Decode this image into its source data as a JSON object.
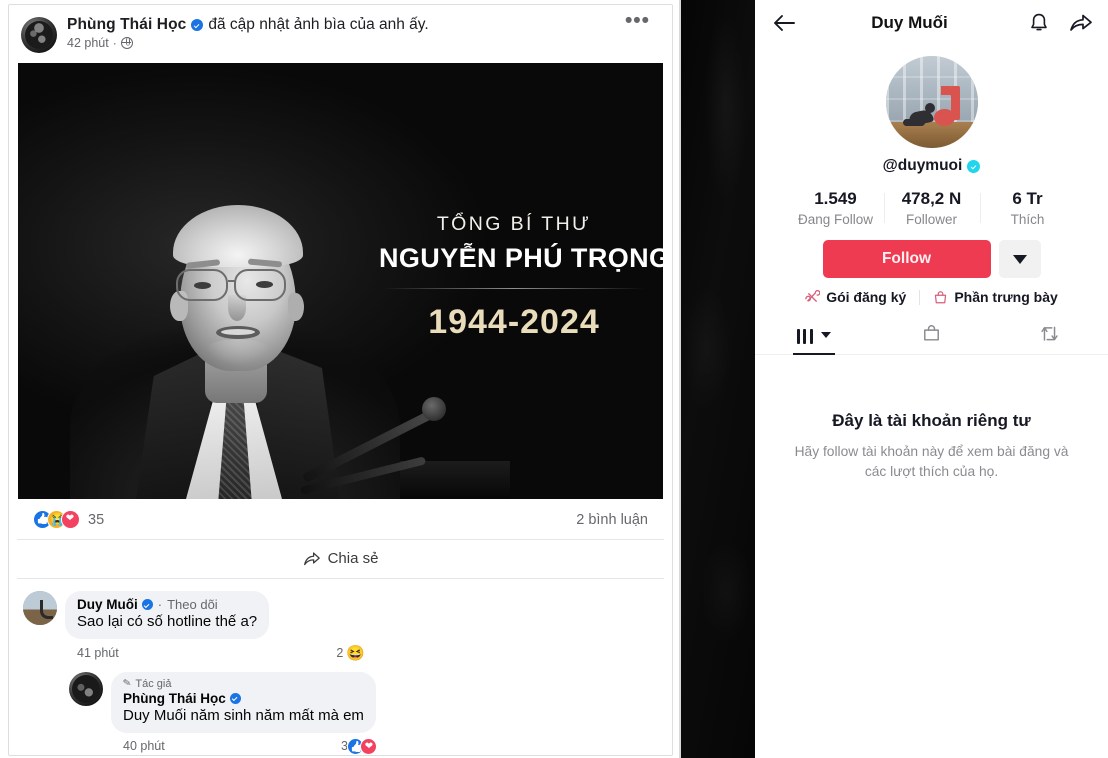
{
  "facebook_post": {
    "author_name": "Phùng Thái Học",
    "action_text": "đã cập nhật ảnh bìa của anh ấy.",
    "timestamp": "42 phút",
    "separator": "·",
    "privacy_icon": "globe-icon",
    "more_menu_icon": "three-dots-icon",
    "memorial_image": {
      "line1": "TỔNG BÍ THƯ",
      "line2": "NGUYỄN PHÚ TRỌNG",
      "line3": "1944-2024",
      "gold_color": "#e9dcbb",
      "background_color": "#0c0c0c"
    },
    "reactions": {
      "icons": [
        "like-reaction-icon",
        "sad-reaction-icon",
        "love-reaction-icon"
      ],
      "count": "35",
      "comments_label": "2 bình luận"
    },
    "share_button": {
      "label": "Chia sẻ",
      "icon": "share-arrow-icon"
    },
    "comments": [
      {
        "author": "Duy Muối",
        "verified": true,
        "follow_label": "Theo dõi",
        "separator": "·",
        "text": "Sao lại có số hotline thế a?",
        "time": "41 phút",
        "reaction_count": "2",
        "reaction_emoji": "😆"
      }
    ],
    "reply": {
      "author_tag": "Tác giả",
      "author_tag_icon": "pencil-icon",
      "author": "Phùng Thái Học",
      "verified": true,
      "text": "Duy Muối năm sinh năm mất mà em",
      "time": "40 phút",
      "reaction_count": "3",
      "reaction_icons": [
        "like-reaction-icon",
        "love-reaction-icon"
      ]
    }
  },
  "tiktok_profile": {
    "header": {
      "back_icon": "back-arrow-icon",
      "title": "Duy Muối",
      "bell_icon": "bell-icon",
      "share_icon": "share-arrow-icon"
    },
    "avatar_icon": "profile-avatar",
    "handle": "@duymuoi",
    "verified": true,
    "stats": [
      {
        "value": "1.549",
        "label": "Đang Follow"
      },
      {
        "value": "478,2 N",
        "label": "Follower"
      },
      {
        "value": "6 Tr",
        "label": "Thích"
      }
    ],
    "follow_button": {
      "label": "Follow",
      "color": "#ef3b52"
    },
    "dropdown_icon": "chevron-down-icon",
    "links": [
      {
        "label": "Gói đăng ký",
        "icon": "subscription-icon"
      },
      {
        "label": "Phần trưng bày",
        "icon": "showcase-bag-icon"
      }
    ],
    "tabs": [
      {
        "name": "videos-tab",
        "icon": "grid-icon",
        "active": true
      },
      {
        "name": "shop-tab",
        "icon": "shopping-bag-icon",
        "active": false
      },
      {
        "name": "repost-tab",
        "icon": "repost-icon",
        "active": false
      }
    ],
    "private_account": {
      "title": "Đây là tài khoản riêng tư",
      "subtitle": "Hãy follow tài khoản này để xem bài đăng và các lượt thích của họ."
    }
  }
}
